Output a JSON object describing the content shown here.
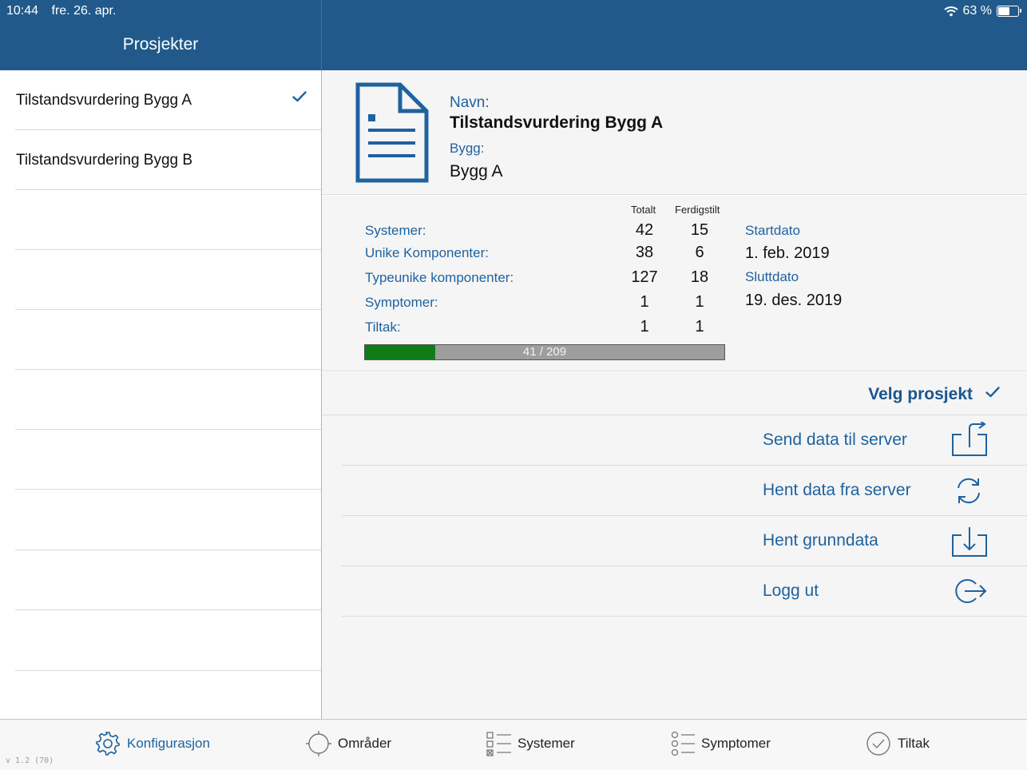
{
  "status_bar": {
    "time": "10:44",
    "date": "fre. 26. apr.",
    "battery": "63 %",
    "battery_level": 0.63
  },
  "sidebar": {
    "title": "Prosjekter",
    "items": [
      {
        "label": "Tilstandsvurdering Bygg A",
        "selected": true
      },
      {
        "label": "Tilstandsvurdering Bygg B",
        "selected": false
      }
    ]
  },
  "project": {
    "name_label": "Navn:",
    "name": "Tilstandsvurdering Bygg A",
    "building_label": "Bygg:",
    "building": "Bygg A"
  },
  "stats": {
    "col_total": "Totalt",
    "col_done": "Ferdigstilt",
    "rows": [
      {
        "label": "Systemer:",
        "total": "42",
        "done": "15"
      },
      {
        "label": "Unike Komponenter:",
        "total": "38",
        "done": "6"
      },
      {
        "label": "Typeunike komponenter:",
        "total": "127",
        "done": "18"
      },
      {
        "label": "Symptomer:",
        "total": "1",
        "done": "1"
      },
      {
        "label": "Tiltak:",
        "total": "1",
        "done": "1"
      }
    ],
    "start_label": "Startdato",
    "start_value": "1. feb. 2019",
    "end_label": "Sluttdato",
    "end_value": "19. des. 2019",
    "progress_text": "41 / 209",
    "progress_done": 41,
    "progress_total": 209
  },
  "actions": {
    "select_label": "Velg prosjekt",
    "items": [
      {
        "label": "Send data til server",
        "icon": "upload-icon"
      },
      {
        "label": "Hent data fra server",
        "icon": "sync-icon"
      },
      {
        "label": "Hent grunndata",
        "icon": "download-icon"
      },
      {
        "label": "Logg ut",
        "icon": "logout-icon"
      }
    ]
  },
  "tabbar": {
    "tabs": [
      {
        "label": "Konfigurasjon",
        "icon": "gear-icon",
        "active": true
      },
      {
        "label": "Områder",
        "icon": "area-icon",
        "active": false
      },
      {
        "label": "Systemer",
        "icon": "list-checkbox-icon",
        "active": false
      },
      {
        "label": "Symptomer",
        "icon": "list-circle-icon",
        "active": false
      },
      {
        "label": "Tiltak",
        "icon": "check-circle-icon",
        "active": false
      }
    ],
    "version": "v 1.2 (70)"
  },
  "colors": {
    "header": "#215a8a",
    "accent": "#1e62a0",
    "progress": "#0e7d16"
  }
}
